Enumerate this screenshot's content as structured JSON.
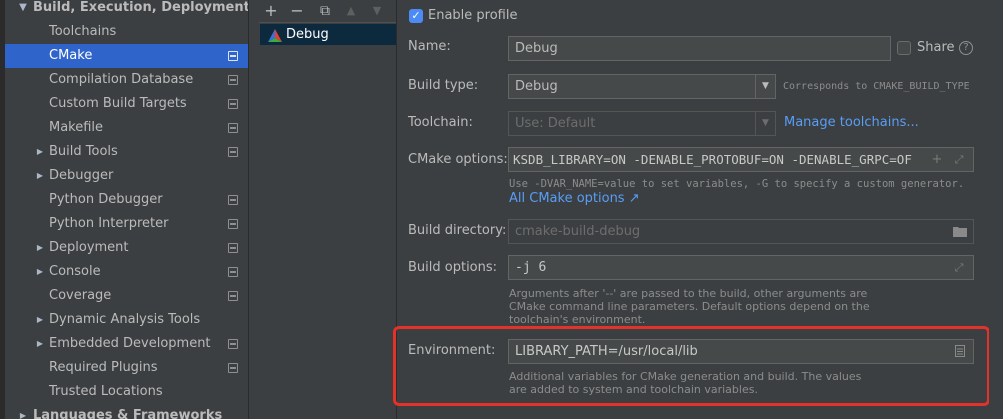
{
  "tree": {
    "items": [
      {
        "label": "Build, Execution, Deployment",
        "arrow": "down",
        "bold": true,
        "modified": false,
        "selected": false,
        "level": 0
      },
      {
        "label": "Toolchains",
        "arrow": "",
        "modified": false,
        "selected": false,
        "level": 2
      },
      {
        "label": "CMake",
        "arrow": "",
        "modified": true,
        "selected": true,
        "level": 2
      },
      {
        "label": "Compilation Database",
        "arrow": "",
        "modified": true,
        "selected": false,
        "level": 2
      },
      {
        "label": "Custom Build Targets",
        "arrow": "",
        "modified": true,
        "selected": false,
        "level": 2
      },
      {
        "label": "Makefile",
        "arrow": "",
        "modified": true,
        "selected": false,
        "level": 2
      },
      {
        "label": "Build Tools",
        "arrow": "right",
        "modified": true,
        "selected": false,
        "level": 1
      },
      {
        "label": "Debugger",
        "arrow": "right",
        "modified": false,
        "selected": false,
        "level": 1
      },
      {
        "label": "Python Debugger",
        "arrow": "",
        "modified": true,
        "selected": false,
        "level": 2
      },
      {
        "label": "Python Interpreter",
        "arrow": "",
        "modified": true,
        "selected": false,
        "level": 2
      },
      {
        "label": "Deployment",
        "arrow": "right",
        "modified": true,
        "selected": false,
        "level": 1
      },
      {
        "label": "Console",
        "arrow": "right",
        "modified": true,
        "selected": false,
        "level": 1
      },
      {
        "label": "Coverage",
        "arrow": "",
        "modified": true,
        "selected": false,
        "level": 2
      },
      {
        "label": "Dynamic Analysis Tools",
        "arrow": "right",
        "modified": false,
        "selected": false,
        "level": 1
      },
      {
        "label": "Embedded Development",
        "arrow": "right",
        "modified": true,
        "selected": false,
        "level": 1
      },
      {
        "label": "Required Plugins",
        "arrow": "",
        "modified": true,
        "selected": false,
        "level": 2
      },
      {
        "label": "Trusted Locations",
        "arrow": "",
        "modified": false,
        "selected": false,
        "level": 2
      },
      {
        "label": "Languages & Frameworks",
        "arrow": "right",
        "bold": true,
        "modified": false,
        "selected": false,
        "level": 0
      }
    ]
  },
  "profiles": {
    "toolbar": {
      "add": "+",
      "remove": "−",
      "copy": "⧉",
      "up": "▲",
      "down": "▼"
    },
    "items": [
      {
        "label": "Debug"
      }
    ]
  },
  "form": {
    "enable_profile": {
      "label": "Enable profile",
      "checked": true
    },
    "name": {
      "label": "Name:",
      "value": "Debug"
    },
    "share": {
      "label": "Share",
      "checked": false
    },
    "build_type": {
      "label": "Build type:",
      "value": "Debug",
      "note": "Corresponds to CMAKE_BUILD_TYPE"
    },
    "toolchain": {
      "label": "Toolchain:",
      "value": "Use: Default",
      "link": "Manage toolchains..."
    },
    "cmake_options": {
      "label": "CMake options:",
      "value": "KSDB_LIBRARY=ON -DENABLE_PROTOBUF=ON -DENABLE_GRPC=OF",
      "hint": "Use -DVAR_NAME=value to set variables, -G to specify a custom generator.",
      "link": "All CMake options ↗"
    },
    "build_directory": {
      "label": "Build directory:",
      "placeholder": "cmake-build-debug"
    },
    "build_options": {
      "label": "Build options:",
      "value": "-j 6",
      "hint_lines": [
        "Arguments after '--' are passed to the build, other arguments are",
        "CMake command line parameters. Default options depend on the",
        "toolchain's environment."
      ]
    },
    "environment": {
      "label": "Environment:",
      "value": "LIBRARY_PATH=/usr/local/lib",
      "hint_lines": [
        "Additional variables for CMake generation and build. The values",
        "are added to system and toolchain variables."
      ]
    }
  },
  "colors": {
    "accent": "#2f65ca",
    "highlight": "#e2322a",
    "link": "#589df6"
  }
}
